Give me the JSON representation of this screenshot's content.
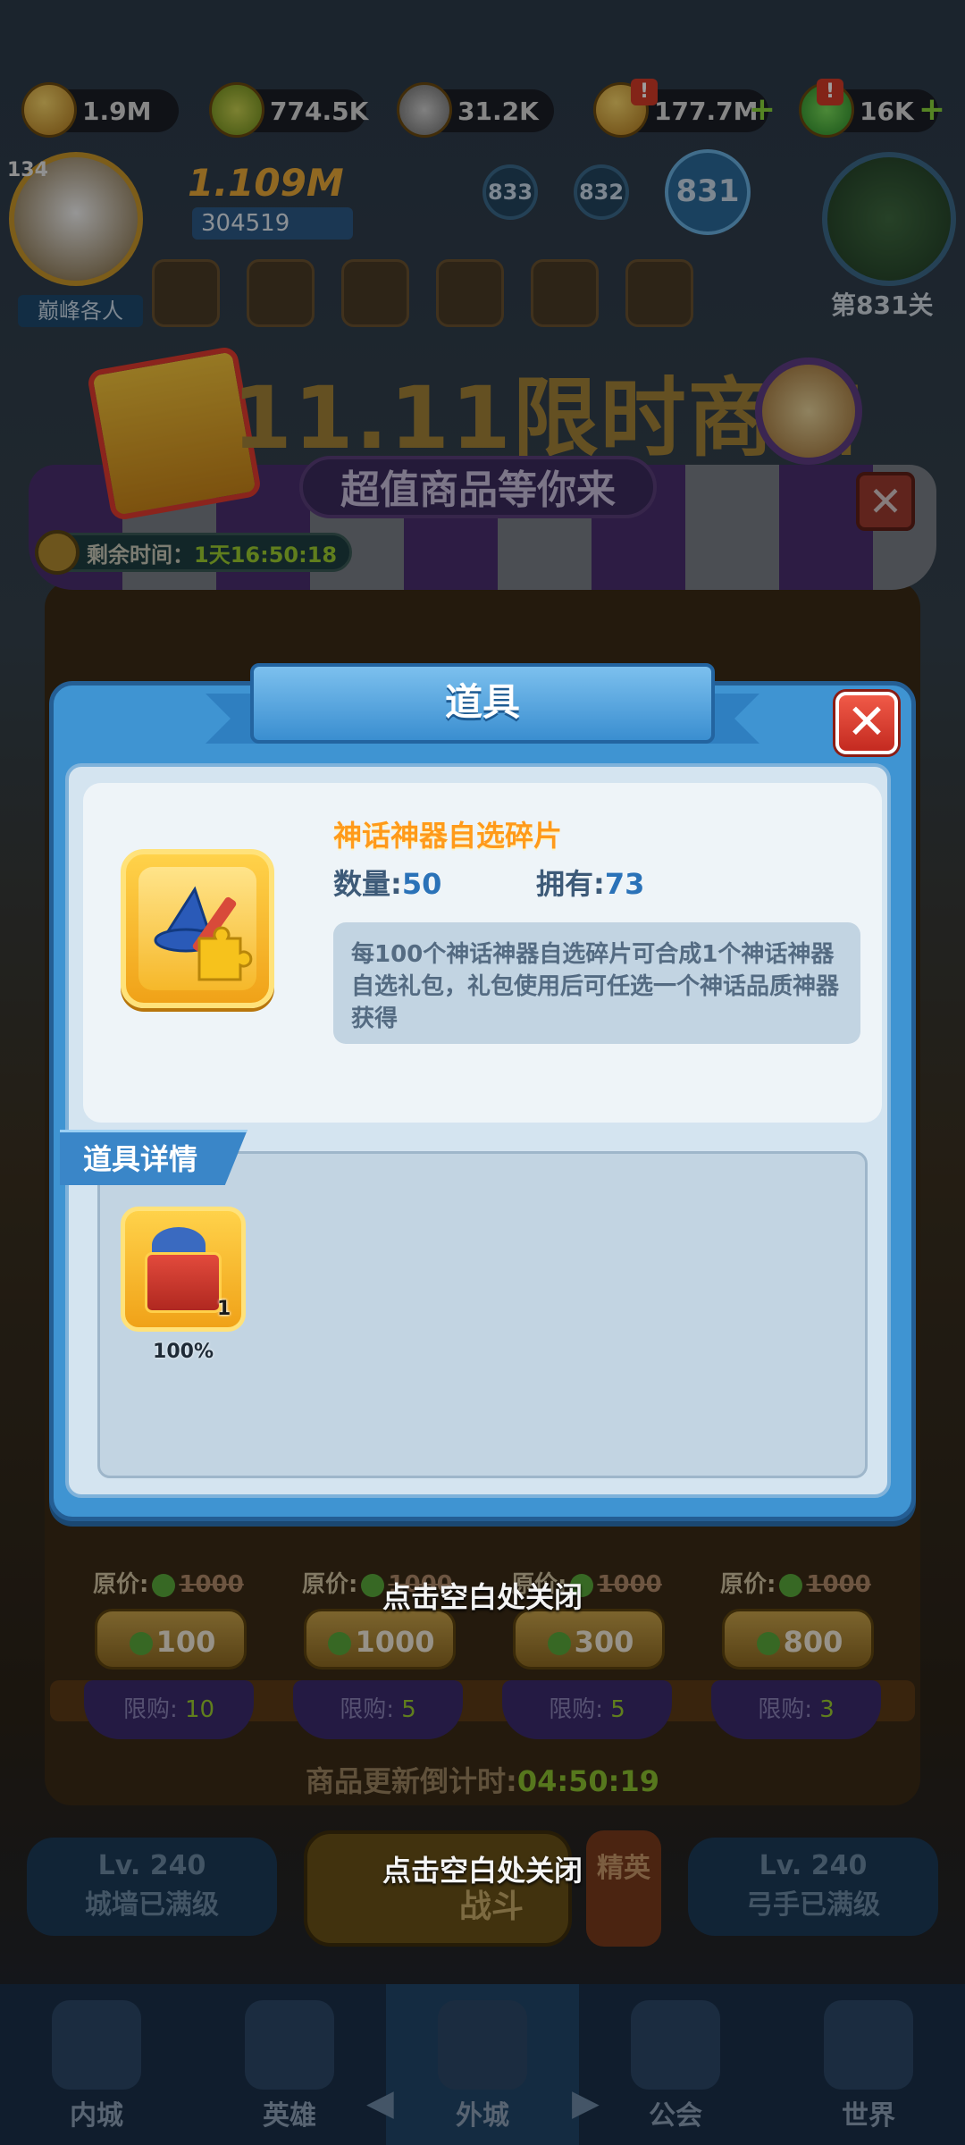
{
  "resources": [
    {
      "name": "gold-coin-resource",
      "value": "1.9M"
    },
    {
      "name": "energy-resource",
      "value": "774.5K"
    },
    {
      "name": "iron-resource",
      "value": "31.2K"
    },
    {
      "name": "food-resource",
      "value": "177.7M"
    },
    {
      "name": "gem-resource",
      "value": "16K"
    }
  ],
  "player": {
    "level": "134",
    "power": "1.109M",
    "id": "304519",
    "title": "巅峰各人"
  },
  "stages": {
    "nodes": [
      "833",
      "832",
      "831"
    ],
    "current_label": "第831关"
  },
  "shop": {
    "title": "11.11限时商店",
    "subtitle": "超值商品等你来",
    "remaining_label": "剩余时间：",
    "remaining_time": "1天16:50:18",
    "close_symbol": "✕",
    "items": [
      {
        "orig_label": "原价:",
        "orig_price": "1000",
        "price": "100",
        "limit_label": "限购: ",
        "limit": "10"
      },
      {
        "orig_label": "原价:",
        "orig_price": "1000",
        "price": "1000",
        "limit_label": "限购: ",
        "limit": "5"
      },
      {
        "orig_label": "原价:",
        "orig_price": "1000",
        "price": "300",
        "limit_label": "限购: ",
        "limit": "5"
      },
      {
        "orig_label": "原价:",
        "orig_price": "1000",
        "price": "800",
        "limit_label": "限购: ",
        "limit": "3"
      }
    ],
    "refresh_label": "商品更新倒计时:",
    "refresh_time": "04:50:19"
  },
  "hints": {
    "close_tap": "点击空白处关闭"
  },
  "bottom": {
    "left_wall_level": "Lv. 240",
    "left_wall_status": "城墙已满级",
    "battle": "战斗",
    "elite": "精英",
    "right_level": "Lv. 240",
    "right_status": "弓手已满级"
  },
  "nav": [
    "内城",
    "英雄",
    "外城",
    "公会",
    "世界"
  ],
  "modal": {
    "title": "道具",
    "close_symbol": "✕",
    "item_name": "神话神器自选碎片",
    "qty_label": "数量:",
    "qty_value": "50",
    "own_label": "拥有:",
    "own_value": "73",
    "description": "每100个神话神器自选碎片可合成1个神话神器自选礼包，礼包使用后可任选一个神话品质神器获得",
    "detail_tab": "道具详情",
    "reward": {
      "count": "1",
      "rate": "100%"
    }
  },
  "colors": {
    "modal_blue": "#3f94d2",
    "item_name_orange": "#ff9a1a",
    "value_blue": "#2a72b8",
    "timer_green": "#9ccc30",
    "close_red": "#e0402e"
  }
}
